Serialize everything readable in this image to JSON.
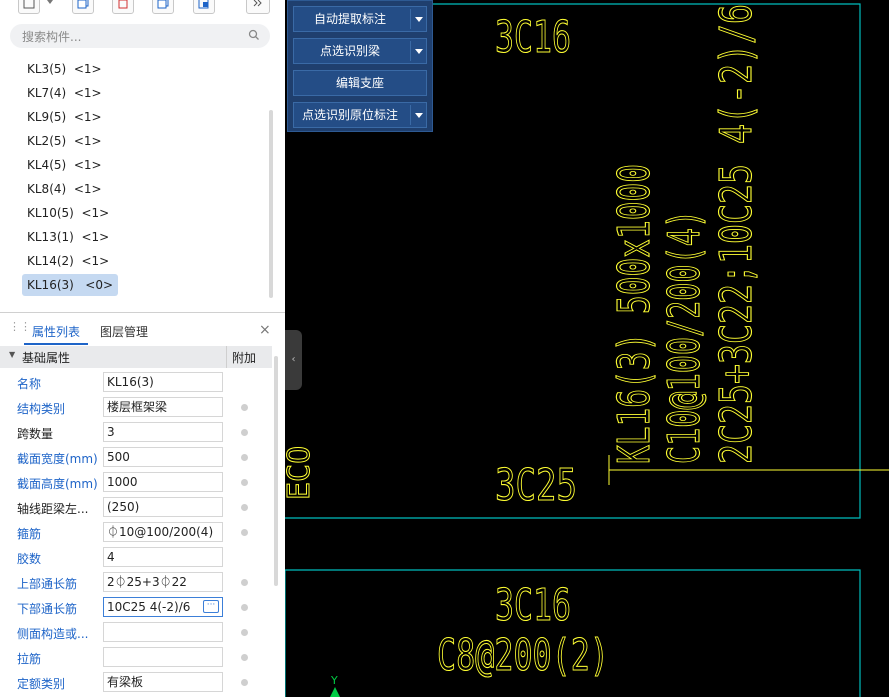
{
  "search": {
    "placeholder": "搜索构件..."
  },
  "components": [
    {
      "name": "KL3(5)",
      "count": "<1>"
    },
    {
      "name": "KL7(4)",
      "count": "<1>"
    },
    {
      "name": "KL9(5)",
      "count": "<1>"
    },
    {
      "name": "KL2(5)",
      "count": "<1>"
    },
    {
      "name": "KL4(5)",
      "count": "<1>"
    },
    {
      "name": "KL8(4)",
      "count": "<1>"
    },
    {
      "name": "KL10(5)",
      "count": "<1>"
    },
    {
      "name": "KL13(1)",
      "count": "<1>"
    },
    {
      "name": "KL14(2)",
      "count": "<1>"
    },
    {
      "name": "KL16(3)",
      "count": "<0>",
      "selected": true
    }
  ],
  "panel_tabs": {
    "properties": "属性列表",
    "layers": "图层管理"
  },
  "property_header": {
    "group": "基础属性",
    "extra": "附加"
  },
  "properties": [
    {
      "label": "名称",
      "value": "KL16(3)"
    },
    {
      "label": "结构类别",
      "value": "楼层框架梁"
    },
    {
      "label": "跨数量",
      "value": "3"
    },
    {
      "label": "截面宽度(mm)",
      "value": "500"
    },
    {
      "label": "截面高度(mm)",
      "value": "1000"
    },
    {
      "label": "轴线距梁左...",
      "value": "(250)"
    },
    {
      "label": "箍筋",
      "value": "⏀10@100/200(4)"
    },
    {
      "label": "胶数",
      "value": "4"
    },
    {
      "label": "上部通长筋",
      "value": "2⏀25+3⏀22"
    },
    {
      "label": "下部通长筋",
      "value": "10C25 4(-2)/6"
    },
    {
      "label": "侧面构造或...",
      "value": ""
    },
    {
      "label": "拉筋",
      "value": ""
    },
    {
      "label": "定额类别",
      "value": "有梁板"
    }
  ],
  "commands": {
    "auto_extract": "自动提取标注",
    "point_identify_beam": "点选识别梁",
    "edit_support": "编辑支座",
    "point_identify_original": "点选识别原位标注"
  },
  "cad": {
    "labels": {
      "top_left": "3C16",
      "bottom_left": "3C25",
      "beam_name": "KL16(3) 500x1000",
      "stirrup": "C10@100/200(4)",
      "top_bars": "2C25+3C22;10C25 4(-2)/6",
      "lower_top": "3C16",
      "lower_stirrup": "C8@200(2)",
      "axis_y": "Y"
    },
    "colors": {
      "text": "#ffff33",
      "frame": "#00bcbc",
      "axis": "#00cc44"
    }
  }
}
